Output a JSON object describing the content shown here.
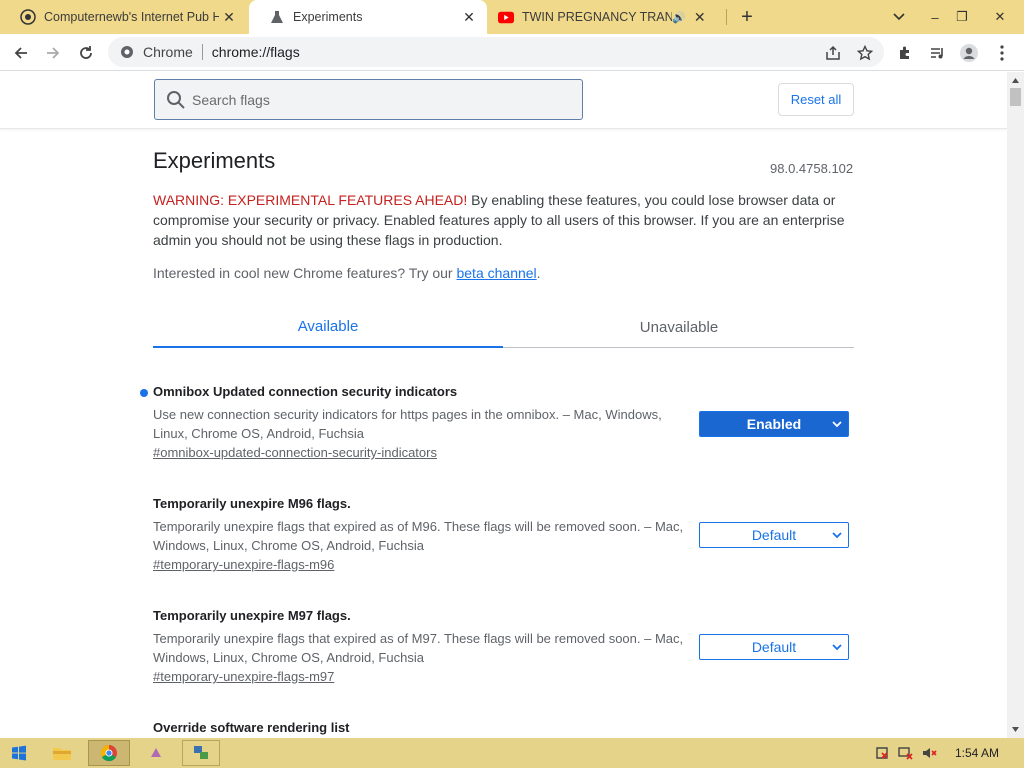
{
  "browser": {
    "tabs": [
      {
        "title": "Computernewb's Internet Pub H",
        "active": false
      },
      {
        "title": "Experiments",
        "active": true
      },
      {
        "title": "TWIN PREGNANCY TRANSFU",
        "active": false,
        "audio": true
      }
    ],
    "omnibox": {
      "chip": "Chrome",
      "url": "chrome://flags"
    }
  },
  "page": {
    "search_placeholder": "Search flags",
    "reset_all": "Reset all",
    "heading": "Experiments",
    "version": "98.0.4758.102",
    "warning_prefix": "WARNING: EXPERIMENTAL FEATURES AHEAD!",
    "warning_text": " By enabling these features, you could lose browser data or compromise your security or privacy. Enabled features apply to all users of this browser. If you are an enterprise admin you should not be using these flags in production.",
    "interest_text": "Interested in cool new Chrome features? Try our ",
    "interest_link": "beta channel",
    "interest_end": ".",
    "tab_available": "Available",
    "tab_unavailable": "Unavailable",
    "flags": [
      {
        "name": "Omnibox Updated connection security indicators",
        "desc": "Use new connection security indicators for https pages in the omnibox. – Mac, Windows, Linux, Chrome OS, Android, Fuchsia",
        "link": "#omnibox-updated-connection-security-indicators",
        "value": "Enabled",
        "modified": true
      },
      {
        "name": "Temporarily unexpire M96 flags.",
        "desc": "Temporarily unexpire flags that expired as of M96. These flags will be removed soon. – Mac, Windows, Linux, Chrome OS, Android, Fuchsia",
        "link": "#temporary-unexpire-flags-m96",
        "value": "Default",
        "modified": false
      },
      {
        "name": "Temporarily unexpire M97 flags.",
        "desc": "Temporarily unexpire flags that expired as of M97. These flags will be removed soon. – Mac, Windows, Linux, Chrome OS, Android, Fuchsia",
        "link": "#temporary-unexpire-flags-m97",
        "value": "Default",
        "modified": false
      },
      {
        "name": "Override software rendering list"
      }
    ]
  },
  "taskbar": {
    "clock": "1:54 AM"
  },
  "colors": {
    "accent": "#1a73e8",
    "warning": "#c5221f",
    "tabstrip": "#f0d98a",
    "taskbar": "#e6d38a"
  }
}
